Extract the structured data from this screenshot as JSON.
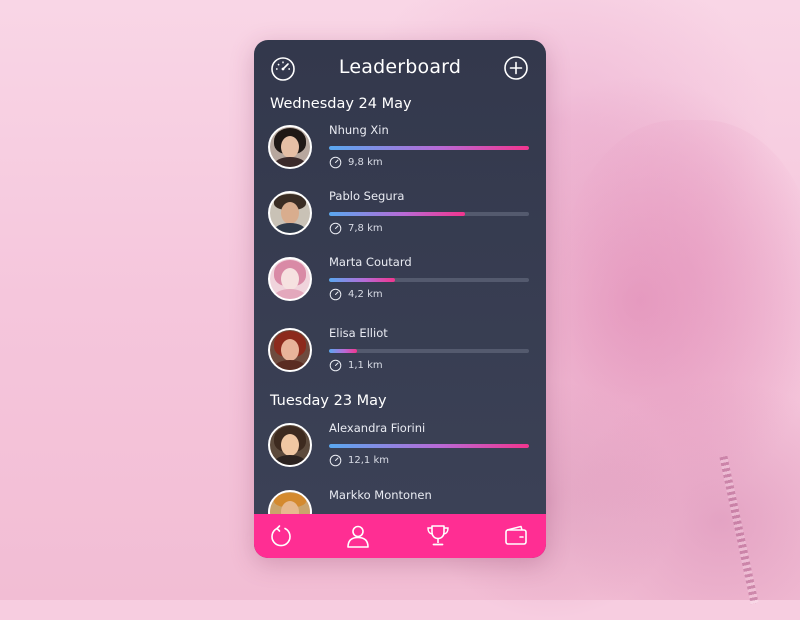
{
  "header": {
    "title": "Leaderboard",
    "left_icon": "speedometer-icon",
    "right_icon": "add-circle-icon"
  },
  "days": [
    {
      "label": "Wednesday 24 May",
      "entries": [
        {
          "name": "Nhung Xin",
          "distance": "9,8 km",
          "progress": 1.0
        },
        {
          "name": "Pablo Segura",
          "distance": "7,8 km",
          "progress": 0.68
        },
        {
          "name": "Marta Coutard",
          "distance": "4,2 km",
          "progress": 0.33
        },
        {
          "name": "Elisa Elliot",
          "distance": "1,1 km",
          "progress": 0.14
        }
      ]
    },
    {
      "label": "Tuesday 23 May",
      "entries": [
        {
          "name": "Alexandra Fiorini",
          "distance": "12,1 km",
          "progress": 1.0
        },
        {
          "name": "Markko Montonen",
          "distance": "",
          "progress": 0
        }
      ]
    }
  ],
  "tabbar": {
    "items": [
      "refresh-icon",
      "profile-icon",
      "trophy-icon",
      "wallet-icon"
    ]
  },
  "colors": {
    "card_top": "#33384c",
    "card_bottom": "#3c4257",
    "tabbar": "#ff2e93",
    "bar_start": "#59a8f0",
    "bar_end": "#f2358e",
    "track": "#545a6e",
    "background": "#f7cde0"
  }
}
